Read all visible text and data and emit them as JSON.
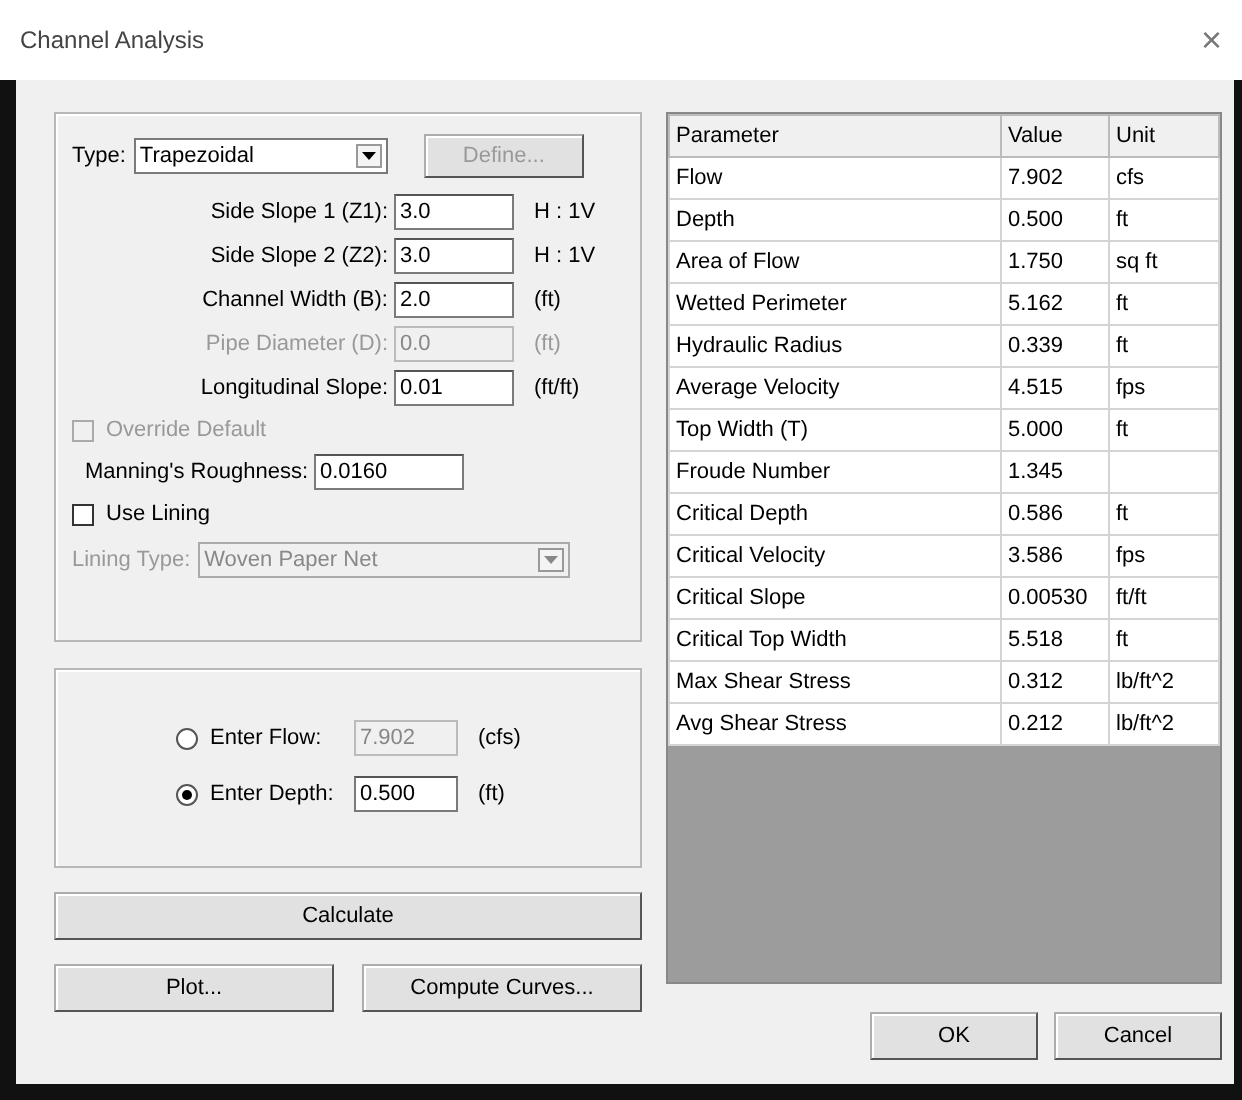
{
  "window": {
    "title": "Channel Analysis",
    "close": "×"
  },
  "type_row": {
    "label": "Type:",
    "value": "Trapezoidal",
    "button": "Define...",
    "button_disabled": true
  },
  "fields": [
    {
      "label": "Side Slope 1 (Z1):",
      "value": "3.0",
      "unit": "H : 1V",
      "disabled": false
    },
    {
      "label": "Side Slope 2 (Z2):",
      "value": "3.0",
      "unit": "H : 1V",
      "disabled": false
    },
    {
      "label": "Channel Width (B):",
      "value": "2.0",
      "unit": "(ft)",
      "disabled": false
    },
    {
      "label": "Pipe Diameter (D):",
      "value": "0.0",
      "unit": "(ft)",
      "disabled": true
    },
    {
      "label": "Longitudinal Slope:",
      "value": "0.01",
      "unit": "(ft/ft)",
      "disabled": false
    }
  ],
  "override_default": {
    "label": "Override Default",
    "checked": false,
    "disabled": true
  },
  "roughness": {
    "label": "Manning's Roughness:",
    "value": "0.0160"
  },
  "use_lining": {
    "label": "Use Lining",
    "checked": false,
    "disabled": false
  },
  "lining_type": {
    "label": "Lining Type:",
    "value": "Woven Paper Net",
    "disabled": true
  },
  "inputs": [
    {
      "label": "Enter Flow:",
      "value": "7.902",
      "unit": "(cfs)",
      "selected": false
    },
    {
      "label": "Enter Depth:",
      "value": "0.500",
      "unit": "(ft)",
      "selected": true
    }
  ],
  "buttons_left": {
    "calculate": "Calculate",
    "plot": "Plot...",
    "curves": "Compute Curves..."
  },
  "table": {
    "columns": [
      "Parameter",
      "Value",
      "Unit"
    ],
    "rows": [
      [
        "Flow",
        "7.902",
        "cfs"
      ],
      [
        "Depth",
        "0.500",
        "ft"
      ],
      [
        "Area of Flow",
        "1.750",
        "sq ft"
      ],
      [
        "Wetted Perimeter",
        "5.162",
        "ft"
      ],
      [
        "Hydraulic Radius",
        "0.339",
        "ft"
      ],
      [
        "Average Velocity",
        "4.515",
        "fps"
      ],
      [
        "Top Width (T)",
        "5.000",
        "ft"
      ],
      [
        "Froude Number",
        "1.345",
        ""
      ],
      [
        "Critical Depth",
        "0.586",
        "ft"
      ],
      [
        "Critical Velocity",
        "3.586",
        "fps"
      ],
      [
        "Critical Slope",
        "0.00530",
        "ft/ft"
      ],
      [
        "Critical Top Width",
        "5.518",
        "ft"
      ],
      [
        "Max Shear Stress",
        "0.312",
        "lb/ft^2"
      ],
      [
        "Avg Shear Stress",
        "0.212",
        "lb/ft^2"
      ]
    ]
  },
  "buttons_right": [
    "OK",
    "Cancel"
  ]
}
